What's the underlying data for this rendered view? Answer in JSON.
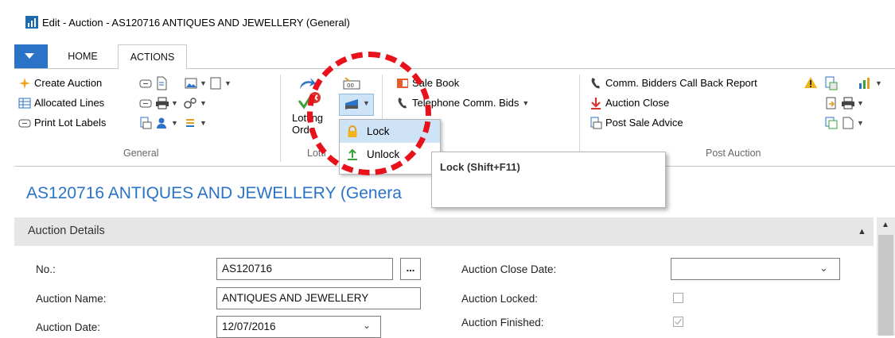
{
  "window": {
    "title": "Edit - Auction - AS120716 ANTIQUES AND JEWELLERY (General)"
  },
  "tabs": {
    "home": "HOME",
    "actions": "ACTIONS"
  },
  "ribbon": {
    "general": {
      "group_label": "General",
      "create_auction": "Create Auction",
      "allocated_lines": "Allocated Lines",
      "print_lot_labels": "Print Lot Labels"
    },
    "lotting": {
      "group_label": "Lotti",
      "lotting_order_line1": "Lotting",
      "lotting_order_line2": "Orde"
    },
    "sale": {
      "sale_book": "Sale Book",
      "telephone_comm_bids": "Telephone Comm. Bids"
    },
    "post_auction": {
      "group_label": "Post Auction",
      "comm_bidders_report": "Comm. Bidders Call Back Report",
      "auction_close": "Auction Close",
      "post_sale_advice": "Post Sale Advice"
    }
  },
  "dropdown": {
    "lock": "Lock",
    "unlock": "Unlock"
  },
  "tooltip": {
    "text": "Lock (Shift+F11)"
  },
  "page": {
    "heading": "AS120716 ANTIQUES AND JEWELLERY (Genera"
  },
  "fasttab": {
    "title": "Auction Details"
  },
  "fields": {
    "no_label": "No.:",
    "no_value": "AS120716",
    "assist_button": "...",
    "name_label": "Auction Name:",
    "name_value": "ANTIQUES AND JEWELLERY",
    "date_label": "Auction Date:",
    "date_value": "12/07/2016",
    "close_date_label": "Auction Close Date:",
    "close_date_value": "",
    "locked_label": "Auction Locked:",
    "locked_checked": false,
    "finished_label": "Auction Finished:",
    "finished_checked": true
  },
  "colors": {
    "accent": "#2b73c6",
    "annotation": "#e8111c",
    "menu_highlight": "#cfe3f7"
  }
}
